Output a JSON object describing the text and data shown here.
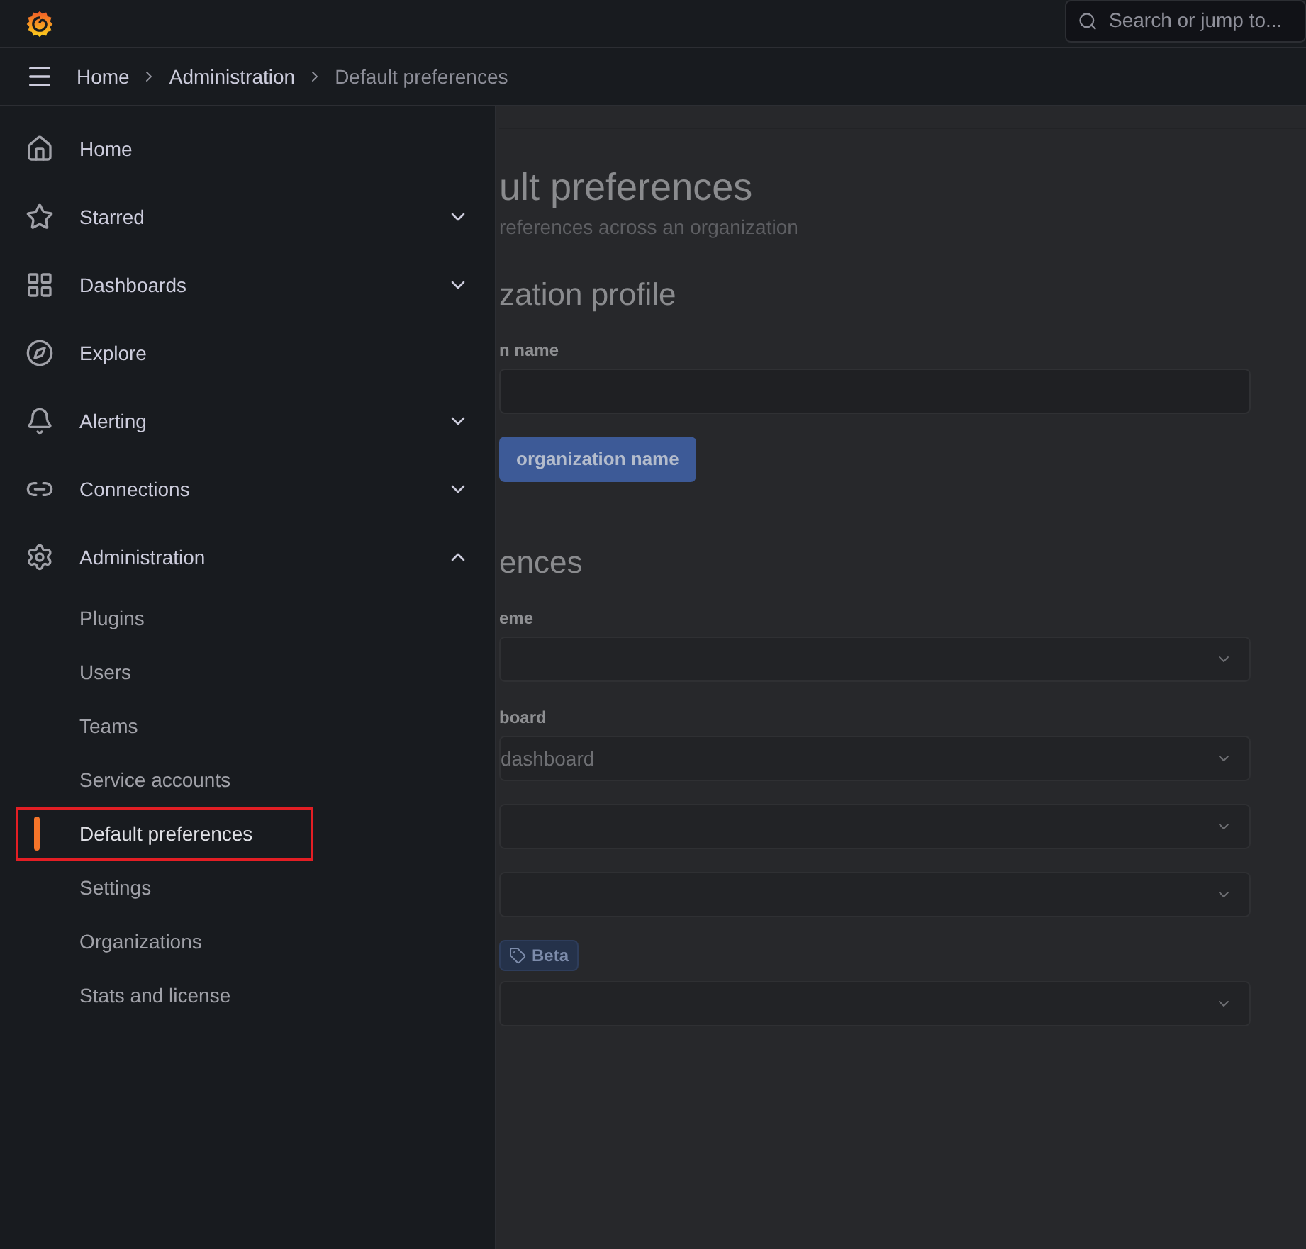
{
  "top_bar": {
    "search": {
      "placeholder": "Search or jump to..."
    }
  },
  "breadcrumbs": [
    {
      "label": "Home",
      "current": false
    },
    {
      "label": "Administration",
      "current": false
    },
    {
      "label": "Default preferences",
      "current": true
    }
  ],
  "sidebar": {
    "items": [
      {
        "label": "Home"
      },
      {
        "label": "Starred",
        "expanded": false
      },
      {
        "label": "Dashboards",
        "expanded": false
      },
      {
        "label": "Explore"
      },
      {
        "label": "Alerting",
        "expanded": false
      },
      {
        "label": "Connections",
        "expanded": false
      },
      {
        "label": "Administration",
        "expanded": true,
        "children": [
          {
            "label": "Plugins",
            "selected": false,
            "highlighted": false
          },
          {
            "label": "Users",
            "selected": false,
            "highlighted": false
          },
          {
            "label": "Teams",
            "selected": false,
            "highlighted": false
          },
          {
            "label": "Service accounts",
            "selected": false,
            "highlighted": false
          },
          {
            "label": "Default preferences",
            "selected": true,
            "highlighted": true
          },
          {
            "label": "Settings",
            "selected": false,
            "highlighted": false
          },
          {
            "label": "Organizations",
            "selected": false,
            "highlighted": false
          },
          {
            "label": "Stats and license",
            "selected": false,
            "highlighted": false
          }
        ]
      }
    ]
  },
  "page": {
    "title": "ult preferences",
    "subtitle": "references across an organization",
    "sections": [
      {
        "heading": "zation profile",
        "fields": [
          {
            "kind": "input",
            "label": "n name"
          },
          {
            "kind": "button",
            "label": "organization name"
          }
        ]
      },
      {
        "heading": "ences",
        "fields": [
          {
            "kind": "select",
            "label": "eme"
          },
          {
            "kind": "select",
            "label": "board",
            "value": "dashboard"
          },
          {
            "kind": "select"
          },
          {
            "kind": "select"
          },
          {
            "kind": "select",
            "badge": "Beta"
          }
        ]
      }
    ]
  }
}
